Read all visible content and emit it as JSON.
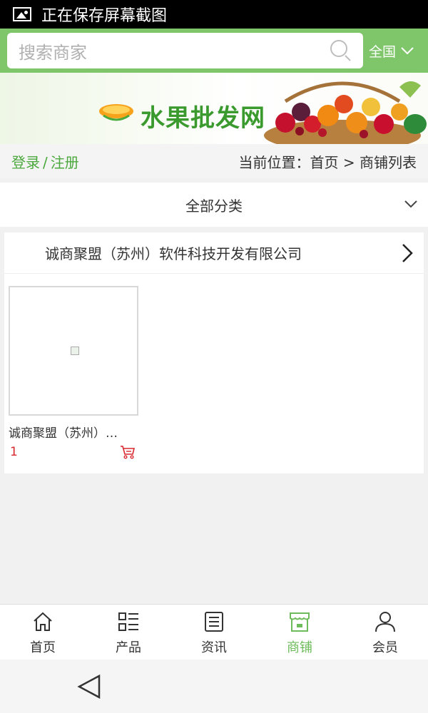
{
  "status_bar": {
    "text": "正在保存屏幕截图"
  },
  "search": {
    "placeholder": "搜索商家",
    "region": "全国"
  },
  "banner": {
    "title": "水果批发网"
  },
  "breadcrumb": {
    "login": "登录",
    "separator": "/",
    "register": "注册",
    "location": "当前位置：首页 > 商铺列表"
  },
  "category": {
    "label": "全部分类"
  },
  "shop": {
    "name": "诚商聚盟（苏州）软件科技开发有限公司",
    "products": [
      {
        "name": "诚商聚盟（苏州）…",
        "price": "1"
      }
    ]
  },
  "tabbar": {
    "items": [
      {
        "label": "首页",
        "icon": "home-icon"
      },
      {
        "label": "产品",
        "icon": "list-icon"
      },
      {
        "label": "资讯",
        "icon": "news-icon"
      },
      {
        "label": "商铺",
        "icon": "shop-icon"
      },
      {
        "label": "会员",
        "icon": "user-icon"
      }
    ],
    "active_index": 3
  },
  "colors": {
    "brand_green": "#7fc66a",
    "active_tab": "#6dbb5a",
    "price_red": "#d9272e",
    "link_green": "#4aa83c"
  }
}
